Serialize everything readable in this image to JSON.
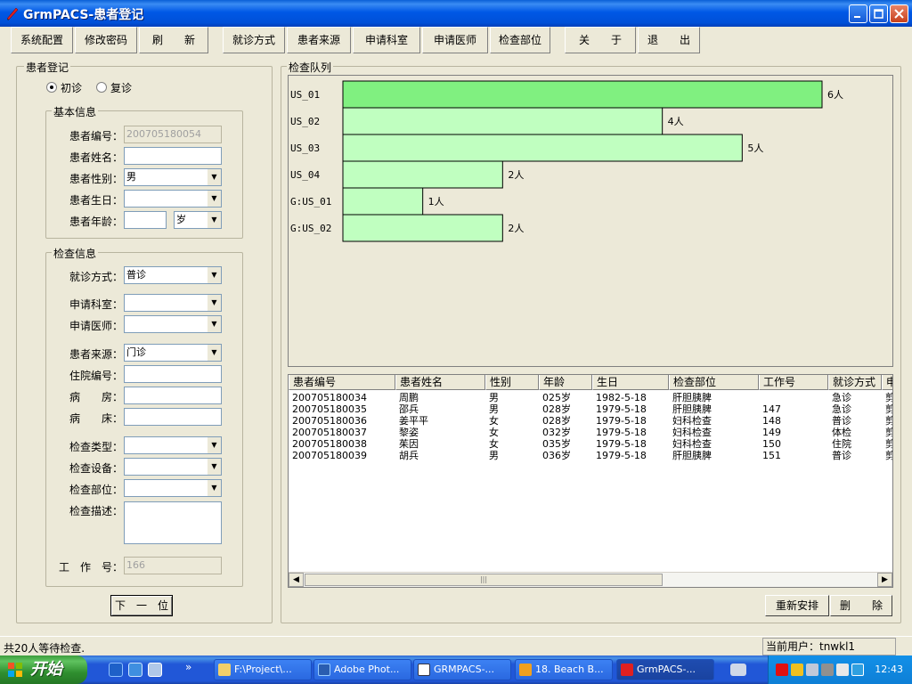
{
  "window": {
    "title": "GrmPACS-患者登记"
  },
  "toolbar": {
    "system_config": "系统配置",
    "change_password": "修改密码",
    "refresh": "刷　　新",
    "visit_type": "就诊方式",
    "patient_source": "患者来源",
    "request_dept": "申请科室",
    "request_doctor": "申请医师",
    "exam_part": "检查部位",
    "about": "关　　于",
    "exit": "退　　出"
  },
  "registration": {
    "group_label": "患者登记",
    "first_visit": "初诊",
    "return_visit": "复诊",
    "first_visit_checked": true
  },
  "basic_info": {
    "group_label": "基本信息",
    "patient_id_label": "患者编号：",
    "patient_id_value": "200705180054",
    "name_label": "患者姓名：",
    "name_value": "",
    "gender_label": "患者性别：",
    "gender_value": "男",
    "birthday_label": "患者生日：",
    "birthday_value": "",
    "age_label": "患者年龄：",
    "age_value": "",
    "age_unit": "岁"
  },
  "exam_info": {
    "group_label": "检查信息",
    "visit_type_label": "就诊方式：",
    "visit_type_value": "普诊",
    "dept_label": "申请科室：",
    "dept_value": "",
    "doctor_label": "申请医师：",
    "doctor_value": "",
    "source_label": "患者来源：",
    "source_value": "门诊",
    "inpatient_label": "住院编号：",
    "inpatient_value": "",
    "ward_label": "病　　房：",
    "ward_value": "",
    "bed_label": "病　　床：",
    "bed_value": "",
    "exam_type_label": "检查类型：",
    "exam_type_value": "",
    "device_label": "检查设备：",
    "device_value": "",
    "part_label": "检查部位：",
    "part_value": "",
    "desc_label": "检查描述：",
    "desc_value": "",
    "work_no_label": "工　作　号：",
    "work_no_value": "166"
  },
  "next_button": "下　一　位",
  "queue": {
    "group_label": "检查队列"
  },
  "chart_data": {
    "type": "bar",
    "orientation": "horizontal",
    "categories": [
      "US_01",
      "US_02",
      "US_03",
      "US_04",
      "G:US_01",
      "G:US_02"
    ],
    "values": [
      6,
      4,
      5,
      2,
      1,
      2
    ],
    "data_labels": [
      "6人",
      "4人",
      "5人",
      "2人",
      "1人",
      "2人"
    ],
    "highlight_index": 0,
    "colors": {
      "highlight": "#80f080",
      "normal": "#c0ffc0",
      "border": "#000000"
    },
    "xlim": [
      0,
      6
    ],
    "grid": false
  },
  "table": {
    "columns": [
      "患者编号",
      "患者姓名",
      "性别",
      "年龄",
      "生日",
      "检查部位",
      "工作号",
      "就诊方式",
      "申"
    ],
    "rows": [
      [
        "200705180034",
        "周鹏",
        "男",
        "025岁",
        "1982-5-18",
        "肝胆胰脾",
        "",
        "急诊",
        "剪"
      ],
      [
        "200705180035",
        "邵兵",
        "男",
        "028岁",
        "1979-5-18",
        "肝胆胰脾",
        "147",
        "急诊",
        "剪"
      ],
      [
        "200705180036",
        "姜平平",
        "女",
        "028岁",
        "1979-5-18",
        "妇科检查",
        "148",
        "普诊",
        "剪"
      ],
      [
        "200705180037",
        "黎姿",
        "女",
        "032岁",
        "1979-5-18",
        "妇科检查",
        "149",
        "体检",
        "剪"
      ],
      [
        "200705180038",
        "茱因",
        "女",
        "035岁",
        "1979-5-18",
        "妇科检查",
        "150",
        "住院",
        "剪"
      ],
      [
        "200705180039",
        "胡兵",
        "男",
        "036岁",
        "1979-5-18",
        "肝胆胰脾",
        "151",
        "普诊",
        "剪"
      ]
    ]
  },
  "actions": {
    "rearrange": "重新安排",
    "delete": "删　　除"
  },
  "status": {
    "waiting": "共20人等待检查.",
    "current_user": "当前用户：tnwkl1"
  },
  "taskbar": {
    "start": "开始",
    "tasks": [
      "F:\\Project\\...",
      "Adobe Phot...",
      "GRMPACS-...",
      "18. Beach B...",
      "GrmPACS-..."
    ],
    "clock": "12:43",
    "colors": {
      "bar": "#2157d7",
      "start": "#3c9c3c",
      "tray": "#1290e8"
    }
  }
}
